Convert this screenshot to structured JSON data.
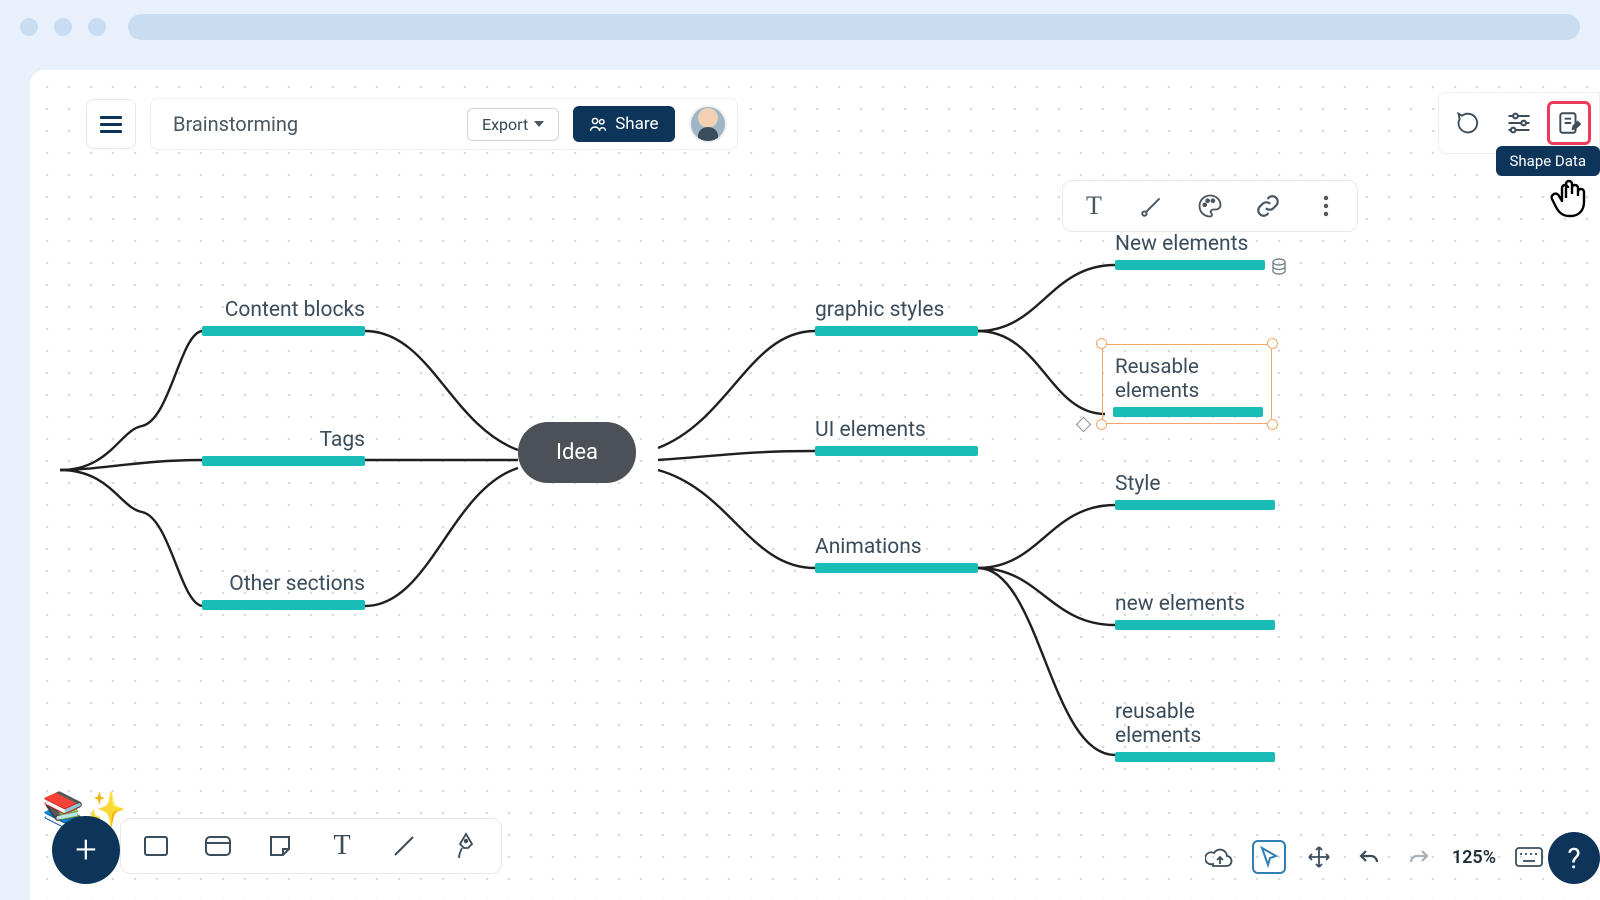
{
  "header": {
    "title": "Brainstorming",
    "export_label": "Export",
    "share_label": "Share"
  },
  "top_right": {
    "tooltip": "Shape Data"
  },
  "mindmap": {
    "center": "Idea",
    "left": {
      "0": "Content blocks",
      "1": "Tags",
      "2": "Other sections"
    },
    "right": {
      "0": "graphic styles",
      "1": "UI elements",
      "2": "Animations"
    },
    "gs_children": {
      "0": "New elements",
      "1": "Reusable\nelements"
    },
    "an_children": {
      "0": "Style",
      "1": "new elements",
      "2": "reusable\nelements"
    }
  },
  "bottom_right": {
    "zoom": "125%"
  }
}
